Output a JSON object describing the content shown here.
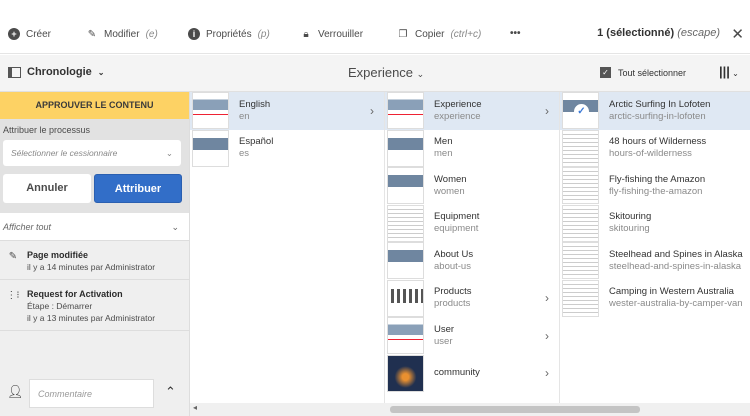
{
  "toolbar": {
    "create": "Créer",
    "edit": "Modifier",
    "edit_key": "(e)",
    "properties": "Propriétés",
    "properties_key": "(p)",
    "lock": "Verrouiller",
    "copy": "Copier",
    "copy_key": "(ctrl+c)",
    "more": "•••",
    "selection": "1 (sélectionné)",
    "escape": "(escape)",
    "close": "✕"
  },
  "header": {
    "rail_label": "Chronologie",
    "title": "Experience",
    "select_all": "Tout sélectionner"
  },
  "rail": {
    "approve": "APPROUVER LE CONTENU",
    "assign_label": "Attribuer le processus",
    "assignee_placeholder": "Sélectionner le cessionnaire",
    "cancel": "Annuler",
    "assign": "Attribuer",
    "show_all": "Afficher tout",
    "events": [
      {
        "title": "Page modifiée",
        "lines": [
          "il y a 14 minutes par Administrator"
        ]
      },
      {
        "title": "Request for Activation",
        "lines": [
          "Étape : Démarrer",
          "il y a 13 minutes par Administrator"
        ]
      }
    ],
    "comment_placeholder": "Commentaire"
  },
  "columns": [
    [
      {
        "name": "English",
        "sub": "en",
        "selected": true,
        "chevron": true
      },
      {
        "name": "Español",
        "sub": "es"
      }
    ],
    [
      {
        "name": "Experience",
        "sub": "experience",
        "selected": true,
        "chevron": true
      },
      {
        "name": "Men",
        "sub": "men"
      },
      {
        "name": "Women",
        "sub": "women"
      },
      {
        "name": "Equipment",
        "sub": "equipment"
      },
      {
        "name": "About Us",
        "sub": "about-us"
      },
      {
        "name": "Products",
        "sub": "products",
        "chevron": true
      },
      {
        "name": "User",
        "sub": "user",
        "chevron": true
      },
      {
        "name": "community",
        "sub": "",
        "chevron": true
      }
    ],
    [
      {
        "name": "Arctic Surfing In Lofoten",
        "sub": "arctic-surfing-in-lofoten",
        "selected": true,
        "checked": true
      },
      {
        "name": "48 hours of Wilderness",
        "sub": "hours-of-wilderness"
      },
      {
        "name": "Fly-fishing the Amazon",
        "sub": "fly-fishing-the-amazon"
      },
      {
        "name": "Skitouring",
        "sub": "skitouring"
      },
      {
        "name": "Steelhead and Spines in Alaska",
        "sub": "steelhead-and-spines-in-alaska"
      },
      {
        "name": "Camping in Western Australia",
        "sub": "wester-australia-by-camper-van"
      }
    ]
  ]
}
